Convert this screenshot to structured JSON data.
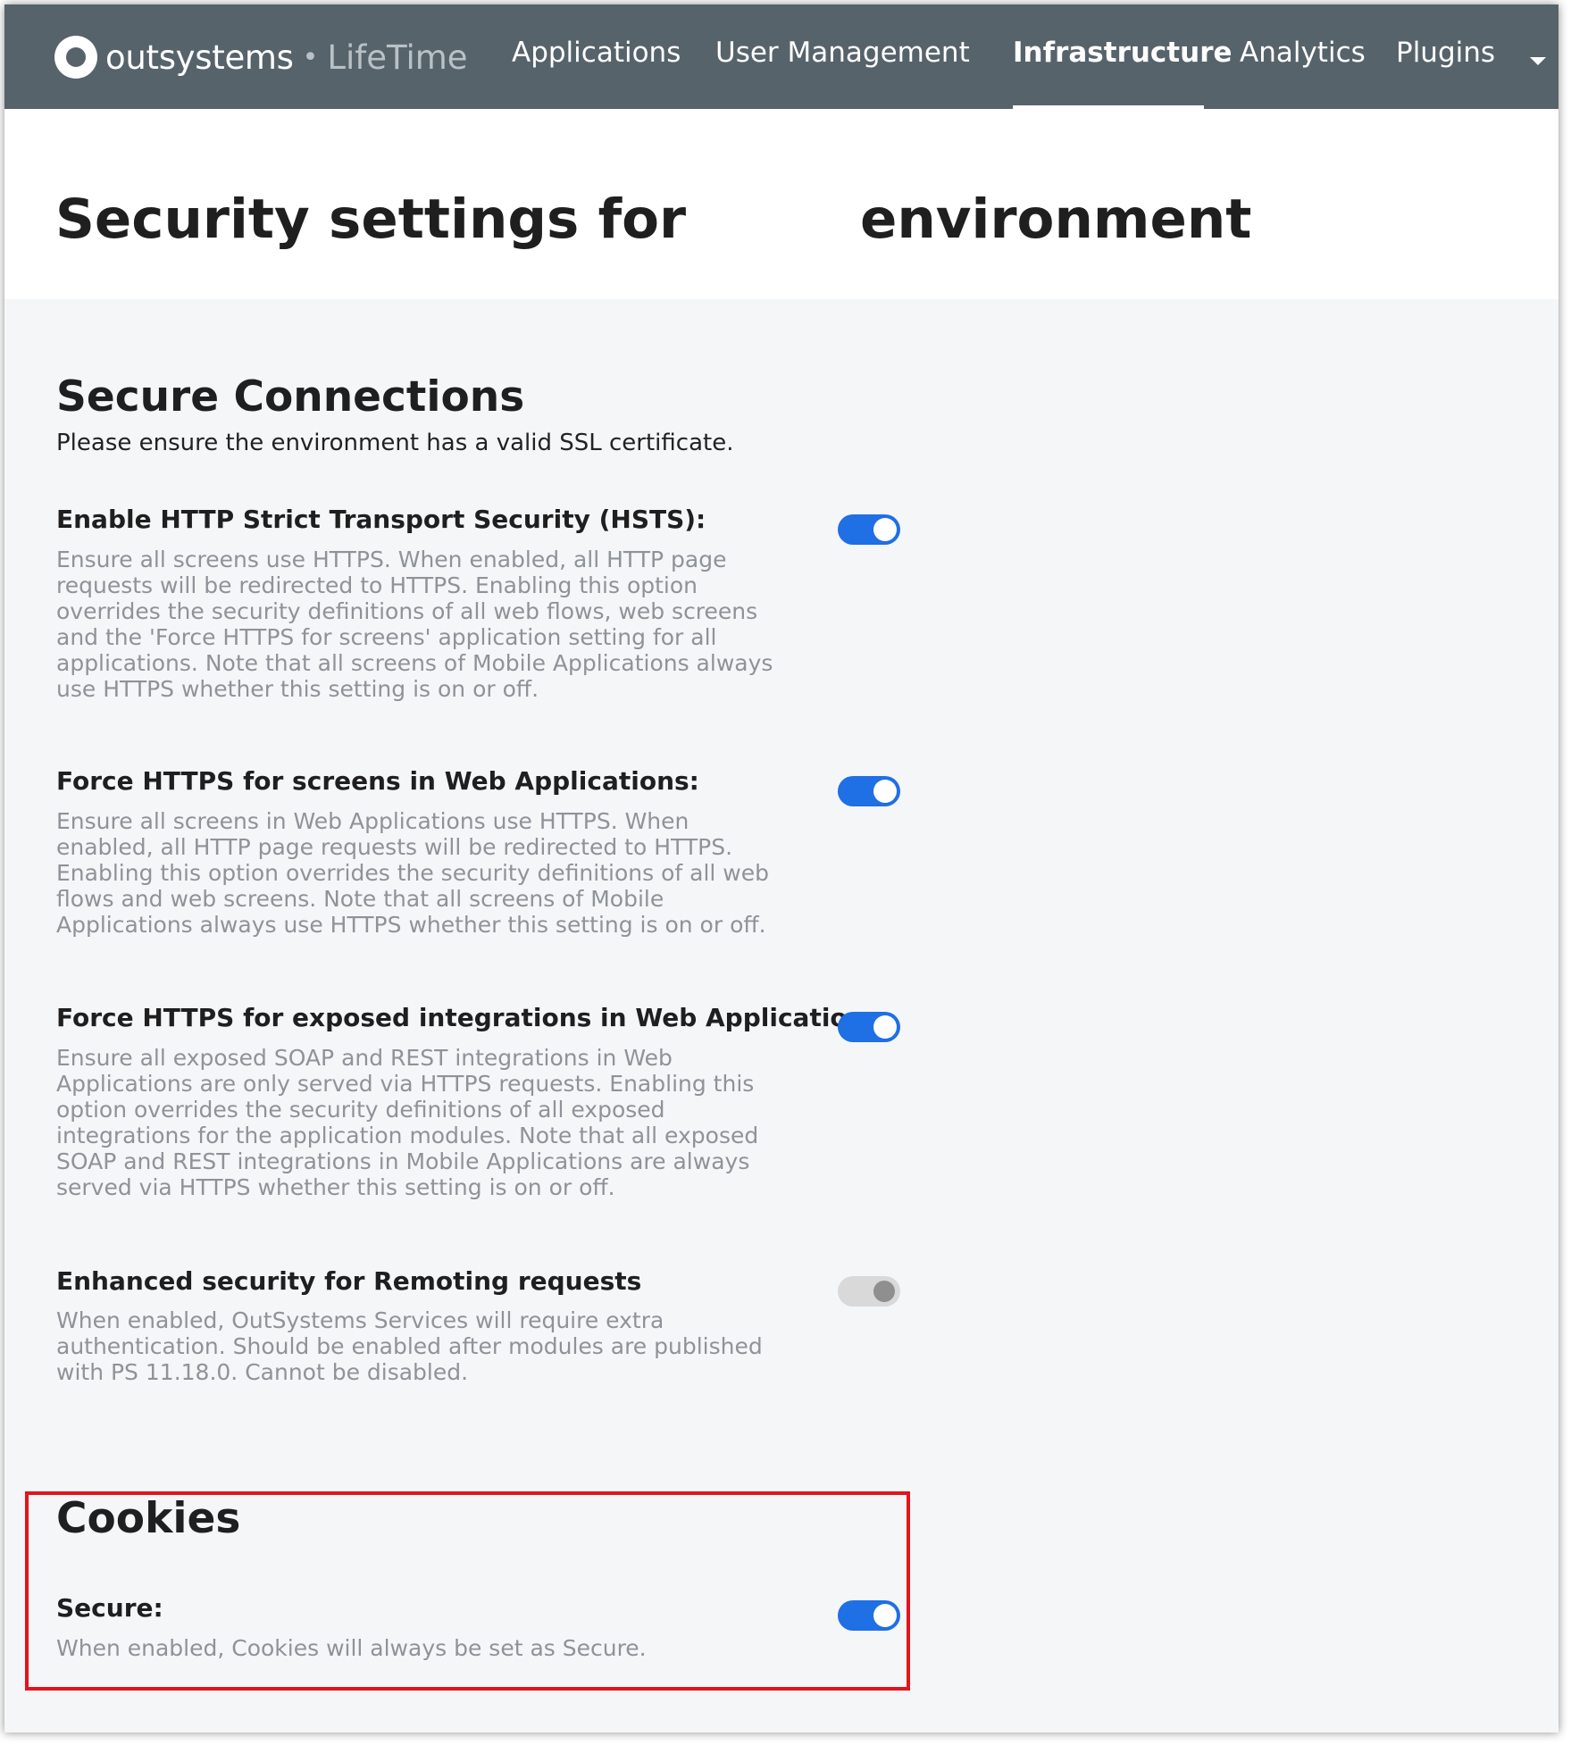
{
  "header": {
    "brand": "outsystems",
    "separator": "•",
    "product": "LifeTime",
    "nav": [
      {
        "label": "Applications",
        "active": false
      },
      {
        "label": "User Management",
        "active": false
      },
      {
        "label": "Infrastructure",
        "active": true
      },
      {
        "label": "Analytics",
        "active": false
      },
      {
        "label": "Plugins",
        "active": false
      }
    ],
    "plugins_dropdown_icon": "caret-down-icon"
  },
  "page": {
    "title_prefix": "Security settings for",
    "title_suffix": "environment"
  },
  "secure_connections": {
    "title": "Secure Connections",
    "subtitle": "Please ensure the environment has a valid SSL certificate.",
    "settings": [
      {
        "title": "Enable HTTP Strict Transport Security (HSTS):",
        "description": "Ensure all screens use HTTPS. When enabled, all HTTP page requests will be redirected to HTTPS. Enabling this option overrides the security definitions of all web flows, web screens and the 'Force HTTPS for screens' application setting for all applications. Note that all screens of Mobile Applications always use HTTPS whether this setting is on or off.",
        "enabled": true,
        "disabled": false
      },
      {
        "title": "Force HTTPS for screens in Web Applications:",
        "description": "Ensure all screens in Web Applications use HTTPS. When enabled, all HTTP page requests will be redirected to HTTPS. Enabling this option overrides the security definitions of all web flows and web screens. Note that all screens of Mobile Applications always use HTTPS whether this setting is on or off.",
        "enabled": true,
        "disabled": false
      },
      {
        "title": "Force HTTPS for exposed integrations in Web Applications:",
        "description": "Ensure all exposed SOAP and REST integrations in Web Applications are only served via HTTPS requests. Enabling this option overrides the security definitions of all exposed integrations for the application modules. Note that all exposed SOAP and REST integrations in Mobile Applications are always served via HTTPS whether this setting is on or off.",
        "enabled": true,
        "disabled": false
      },
      {
        "title": "Enhanced security for Remoting requests",
        "description": "When enabled, OutSystems Services will require extra authentication. Should be enabled after modules are published with PS 11.18.0. Cannot be disabled.",
        "enabled": true,
        "disabled": true
      }
    ]
  },
  "cookies": {
    "title": "Cookies",
    "settings": [
      {
        "title": "Secure:",
        "description": "When enabled, Cookies will always be set as Secure.",
        "enabled": true,
        "disabled": false
      }
    ]
  },
  "colors": {
    "nav_background": "#57636b",
    "toggle_on": "#1f6fe5",
    "toggle_disabled": "#d9d9d9",
    "highlight_border": "#e3141c",
    "description_text": "#8e9398"
  }
}
